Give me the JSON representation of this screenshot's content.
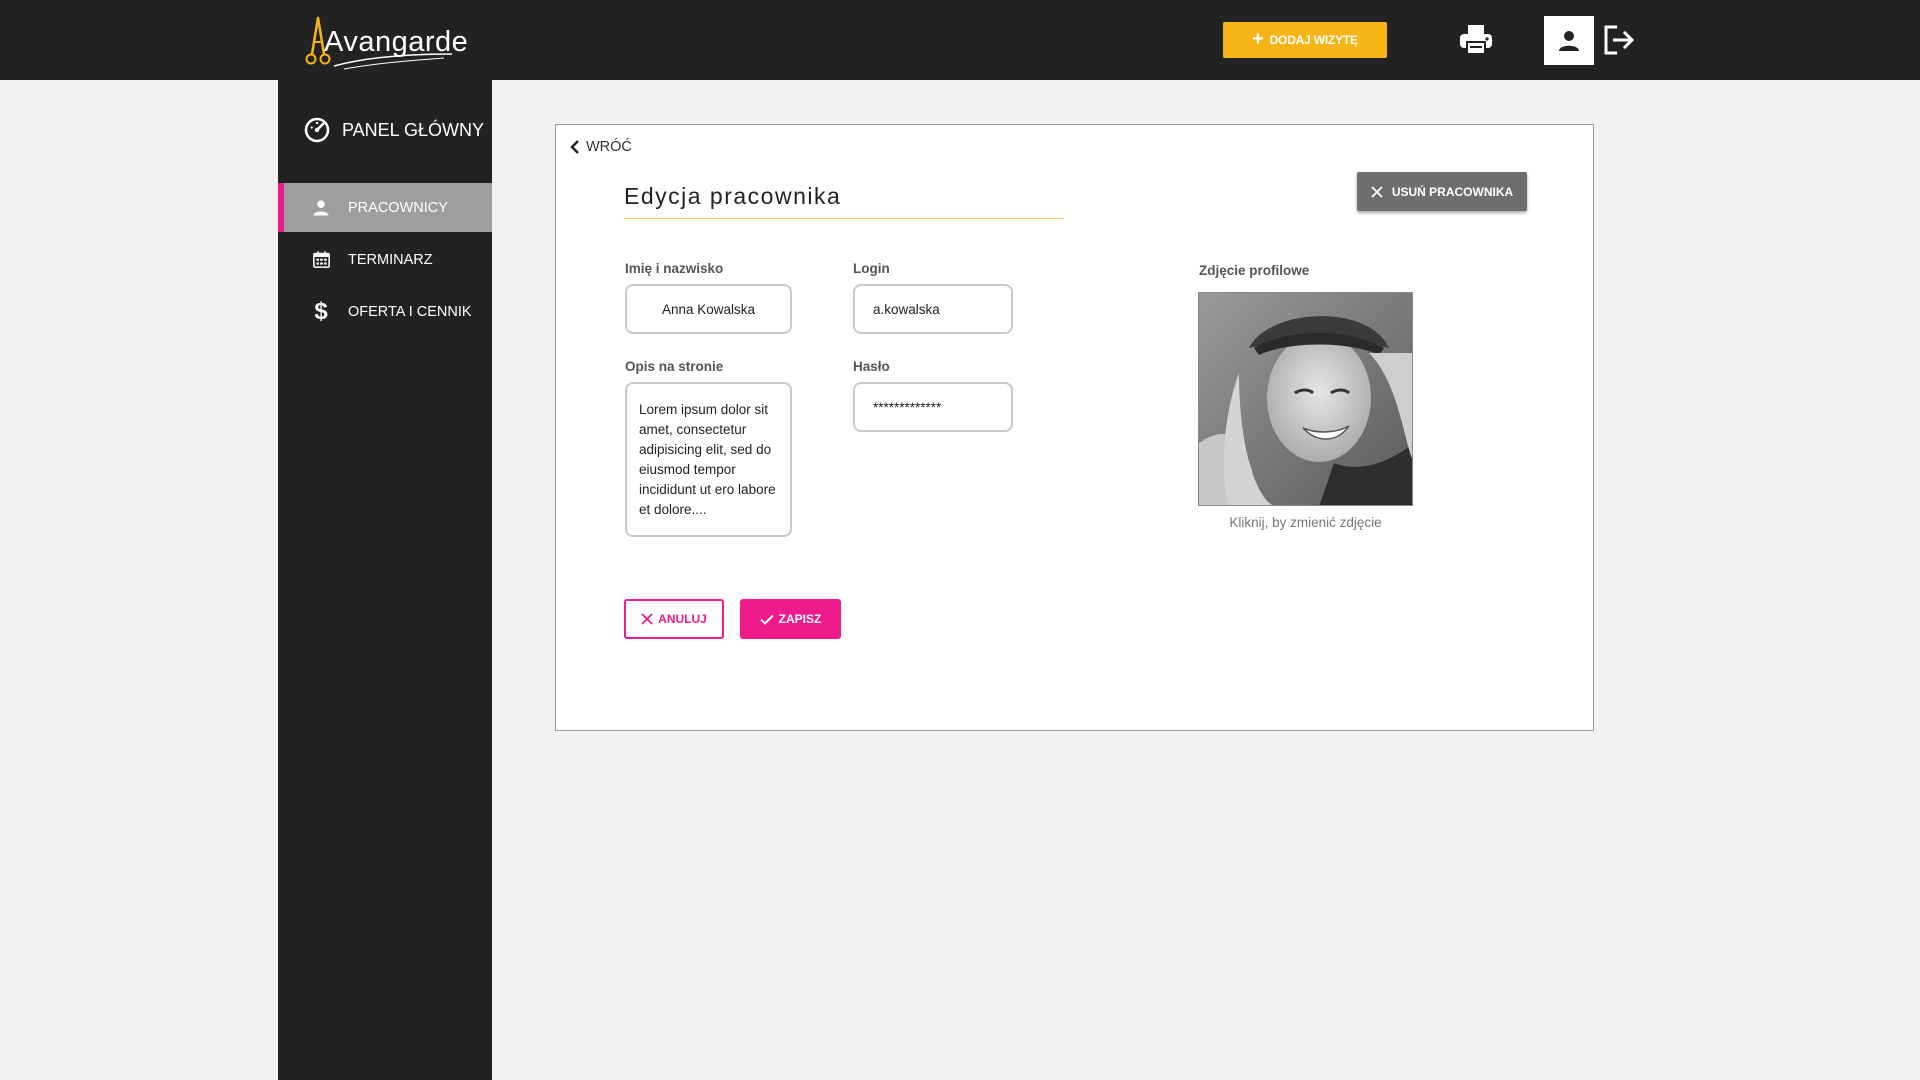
{
  "app": {
    "brand": "Avangarde",
    "accent_color": "#e91e8c",
    "warning_color": "#f7b416"
  },
  "header": {
    "add_visit_label": "DODAJ WIZYTĘ",
    "icons": [
      "plus-icon",
      "printer-icon",
      "user-icon",
      "logout-icon"
    ]
  },
  "sidebar": {
    "dashboard_label": "PANEL GŁÓWNY",
    "items": [
      {
        "label": "PRACOWNICY",
        "icon": "user-icon",
        "active": true
      },
      {
        "label": "TERMINARZ",
        "icon": "calendar-icon",
        "active": false
      },
      {
        "label": "OFERTA I CENNIK",
        "icon": "dollar-icon",
        "active": false
      }
    ]
  },
  "form": {
    "back_label": "WRÓĆ",
    "title": "Edycja pracownika",
    "delete_label": "USUŃ PRACOWNIKA",
    "name_label": "Imię i nazwisko",
    "name_value": "Anna Kowalska",
    "login_label": "Login",
    "login_value": "a.kowalska",
    "description_label": "Opis na stronie",
    "description_value": "Lorem ipsum dolor sit amet, consectetur adipisicing elit, sed do eiusmod tempor incididunt ut ero labore et dolore....",
    "password_label": "Hasło",
    "password_value": "*************",
    "photo_label": "Zdjęcie profilowe",
    "photo_caption": "Kliknij, by zmienić zdjęcie",
    "cancel_label": "ANULUJ",
    "save_label": "ZAPISZ"
  }
}
